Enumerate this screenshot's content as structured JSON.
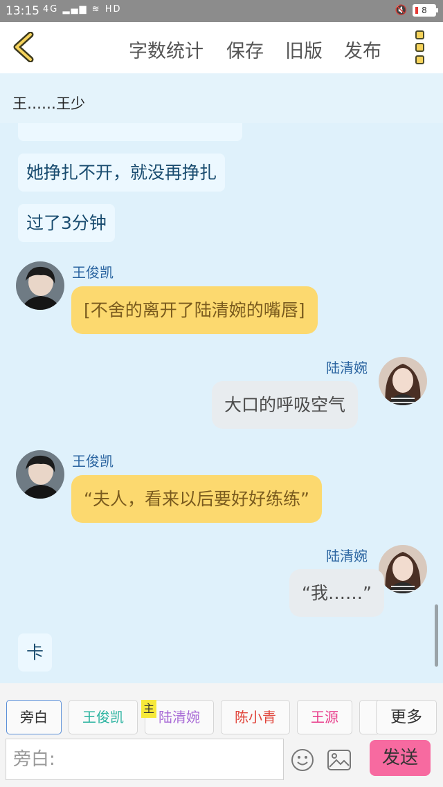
{
  "status_bar": {
    "time": "13:15",
    "signal": "4G",
    "network_badge": "HD",
    "battery": "8"
  },
  "toolbar": {
    "back_icon": "chevron-left-icon",
    "word_count": "字数统计",
    "save": "保存",
    "old_version": "旧版",
    "publish": "发布",
    "menu_icon": "more-vertical-icon"
  },
  "chat": {
    "header_text": "王……王少",
    "messages": [
      {
        "type": "narration",
        "text": "她挣扎不开，就没再挣扎"
      },
      {
        "type": "narration",
        "text": "过了3分钟"
      },
      {
        "type": "left",
        "name": "王俊凯",
        "text": "[不舍的离开了陆清婉的嘴唇]"
      },
      {
        "type": "right",
        "name": "陆清婉",
        "text": "大口的呼吸空气"
      },
      {
        "type": "left",
        "name": "王俊凯",
        "text": "“夫人，看来以后要好好练练”"
      },
      {
        "type": "right",
        "name": "陆清婉",
        "text": "“我……”"
      },
      {
        "type": "narration",
        "text": "卡"
      }
    ]
  },
  "roles": {
    "items": [
      {
        "label": "旁白",
        "color": "#333333"
      },
      {
        "label": "王俊凯",
        "color": "#2bb3a0"
      },
      {
        "label": "陆清婉",
        "color": "#a86ad6"
      },
      {
        "label": "陈小青",
        "color": "#e0443a"
      },
      {
        "label": "王源",
        "color": "#e83c8a"
      }
    ],
    "main_badge": "主",
    "more": "更多"
  },
  "composer": {
    "placeholder": "旁白:",
    "emoji_icon": "smile-icon",
    "image_icon": "image-icon",
    "send": "发送"
  },
  "colors": {
    "chat_bg": "#dff1fb",
    "left_bubble": "#fcd96f",
    "right_bubble": "#e8ecef",
    "send_button": "#f76aa0",
    "name_text": "#2a64a0"
  }
}
